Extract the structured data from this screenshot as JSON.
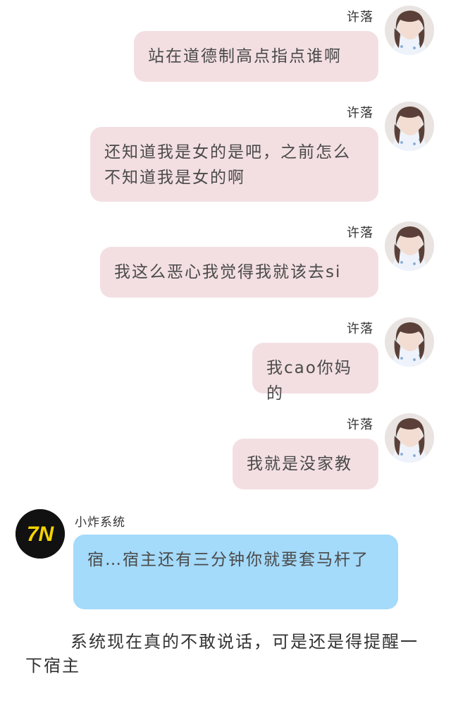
{
  "messages": [
    {
      "sender": "许落",
      "text": "站在道德制高点指点谁啊"
    },
    {
      "sender": "许落",
      "text": "还知道我是女的是吧，之前怎么不知道我是女的啊"
    },
    {
      "sender": "许落",
      "text": "我这么恶心我觉得我就该去si"
    },
    {
      "sender": "许落",
      "text": "我cao你妈的"
    },
    {
      "sender": "许落",
      "text": "我就是没家教"
    },
    {
      "sender": "小炸系统",
      "text": "宿…宿主还有三分钟你就要套马杆了"
    }
  ],
  "system_logo_text": "7N",
  "narration": "系统现在真的不敢说话，可是还是得提醒一下宿主",
  "colors": {
    "pink_bubble": "#f3dfe2",
    "blue_bubble": "#a4dafa",
    "logo_bg": "#111111",
    "logo_fg": "#f5d400"
  }
}
